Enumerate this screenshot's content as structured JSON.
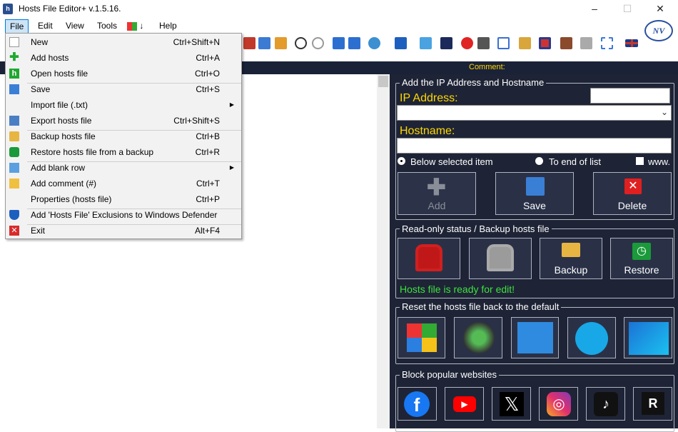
{
  "window": {
    "title": "Hosts File Editor+ v.1.5.16.",
    "app_icon": "h",
    "minimize": "–",
    "maximize": "☐",
    "close": "✕"
  },
  "menubar": {
    "file": "File",
    "edit": "Edit",
    "view": "View",
    "tools": "Tools",
    "windows_arrow": "↓",
    "help": "Help"
  },
  "file_menu": [
    {
      "label": "New",
      "shortcut": "Ctrl+Shift+N",
      "icon": "new-file-icon"
    },
    {
      "label": "Add hosts",
      "shortcut": "Ctrl+A",
      "icon": "green-plus-icon"
    },
    {
      "label": "Open  hosts file",
      "shortcut": "Ctrl+O",
      "icon": "hosts-h-icon"
    },
    {
      "label": "Save",
      "shortcut": "Ctrl+S",
      "icon": "floppy-icon"
    },
    {
      "label": "Import file (.txt)",
      "shortcut": "",
      "icon": "",
      "submenu": true
    },
    {
      "label": "Export hosts file",
      "shortcut": "Ctrl+Shift+S",
      "icon": "export-icon"
    },
    {
      "label": "Backup hosts file",
      "shortcut": "Ctrl+B",
      "icon": "backup-icon"
    },
    {
      "label": "Restore hosts file from a backup",
      "shortcut": "Ctrl+R",
      "icon": "restore-icon"
    },
    {
      "label": "Add blank row",
      "shortcut": "",
      "icon": "blank-row-icon",
      "submenu": true
    },
    {
      "label": "Add comment (#)",
      "shortcut": "Ctrl+T",
      "icon": "folder-comment-icon"
    },
    {
      "label": "Properties (hosts file)",
      "shortcut": "Ctrl+P",
      "icon": ""
    },
    {
      "label": "Add 'Hosts File' Exclusions to Windows Defender",
      "shortcut": "",
      "icon": "shield-icon"
    },
    {
      "label": "Exit",
      "shortcut": "Alt+F4",
      "icon": "exit-icon"
    }
  ],
  "grid": {
    "comment_header": "Comment:"
  },
  "add_group": {
    "title": "Add the IP Address  and Hostname",
    "ip_label": "IP Address:",
    "ip_value": "",
    "ip_combo_value": "",
    "hostname_label": "Hostname:",
    "hostname_value": "",
    "radio_below": "Below selected item",
    "radio_end": "To end of list",
    "www_label": "www.",
    "btn_add": "Add",
    "btn_save": "Save",
    "btn_delete": "Delete"
  },
  "readonly_group": {
    "title": "Read-only status / Backup hosts file",
    "btn_backup": "Backup",
    "btn_restore": "Restore",
    "status": "Hosts file is ready for edit!",
    "status_color": "#3fe03f"
  },
  "reset_group": {
    "title": "Reset the hosts file back to the default",
    "os": [
      {
        "label": "Windows XP",
        "icon": "windows-xp-icon"
      },
      {
        "label": "Vista",
        "icon": "windows-vista-icon"
      },
      {
        "label": "Windows 7",
        "icon": "windows-7-icon"
      },
      {
        "label": "Windows 8",
        "icon": "windows-8-icon"
      },
      {
        "label": "Windows 10, 11",
        "icon": "windows-10-11-icon"
      }
    ]
  },
  "block_group": {
    "title": "Block popular websites",
    "sites": [
      {
        "icon": "facebook-icon",
        "glyph": "f"
      },
      {
        "icon": "youtube-icon",
        "glyph": "▶"
      },
      {
        "icon": "x-twitter-icon",
        "glyph": "𝕏"
      },
      {
        "icon": "instagram-icon",
        "glyph": "◎"
      },
      {
        "icon": "tiktok-icon",
        "glyph": "♪"
      },
      {
        "icon": "roblox-icon",
        "glyph": "R"
      }
    ]
  },
  "colors": {
    "panel_bg": "#1e2436",
    "yellow": "#ffd700",
    "menu_highlight": "#cce4f7"
  }
}
